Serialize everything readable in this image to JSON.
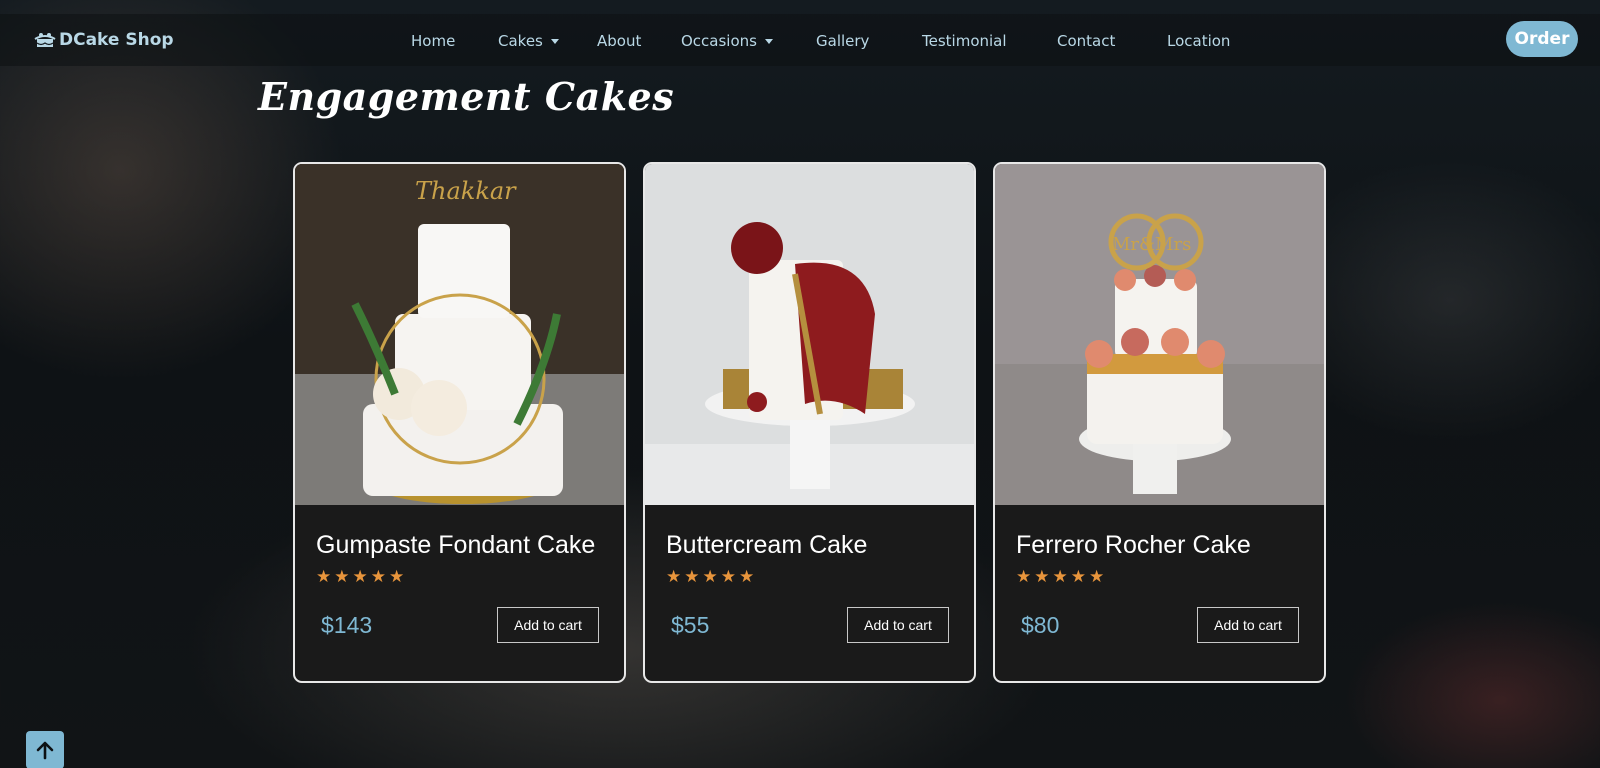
{
  "brand": {
    "name": "DCake Shop",
    "icon": "cake-logo-icon"
  },
  "nav": {
    "items": [
      {
        "label": "Home",
        "has_dropdown": false
      },
      {
        "label": "Cakes",
        "has_dropdown": true
      },
      {
        "label": "About",
        "has_dropdown": false
      },
      {
        "label": "Occasions",
        "has_dropdown": true
      },
      {
        "label": "Gallery",
        "has_dropdown": false
      },
      {
        "label": "Testimonial",
        "has_dropdown": false
      },
      {
        "label": "Contact",
        "has_dropdown": false
      },
      {
        "label": "Location",
        "has_dropdown": false
      }
    ],
    "order_label": "Order"
  },
  "page": {
    "title": "Engagement Cakes"
  },
  "products": [
    {
      "name": "Gumpaste Fondant Cake",
      "rating": 5,
      "price": "$143",
      "cart_label": "Add to cart",
      "image_icon": "white-tiered-cake-photo"
    },
    {
      "name": "Buttercream Cake",
      "rating": 5,
      "price": "$55",
      "cart_label": "Add to cart",
      "image_icon": "red-drape-cake-photo"
    },
    {
      "name": "Ferrero Rocher Cake",
      "rating": 5,
      "price": "$80",
      "cart_label": "Add to cart",
      "image_icon": "mr-mrs-cake-photo"
    }
  ],
  "colors": {
    "accent": "#7fb8d3",
    "star": "#e8953c",
    "nav_text": "#b9d8e6"
  },
  "back_to_top": {
    "icon": "arrow-up-icon"
  }
}
